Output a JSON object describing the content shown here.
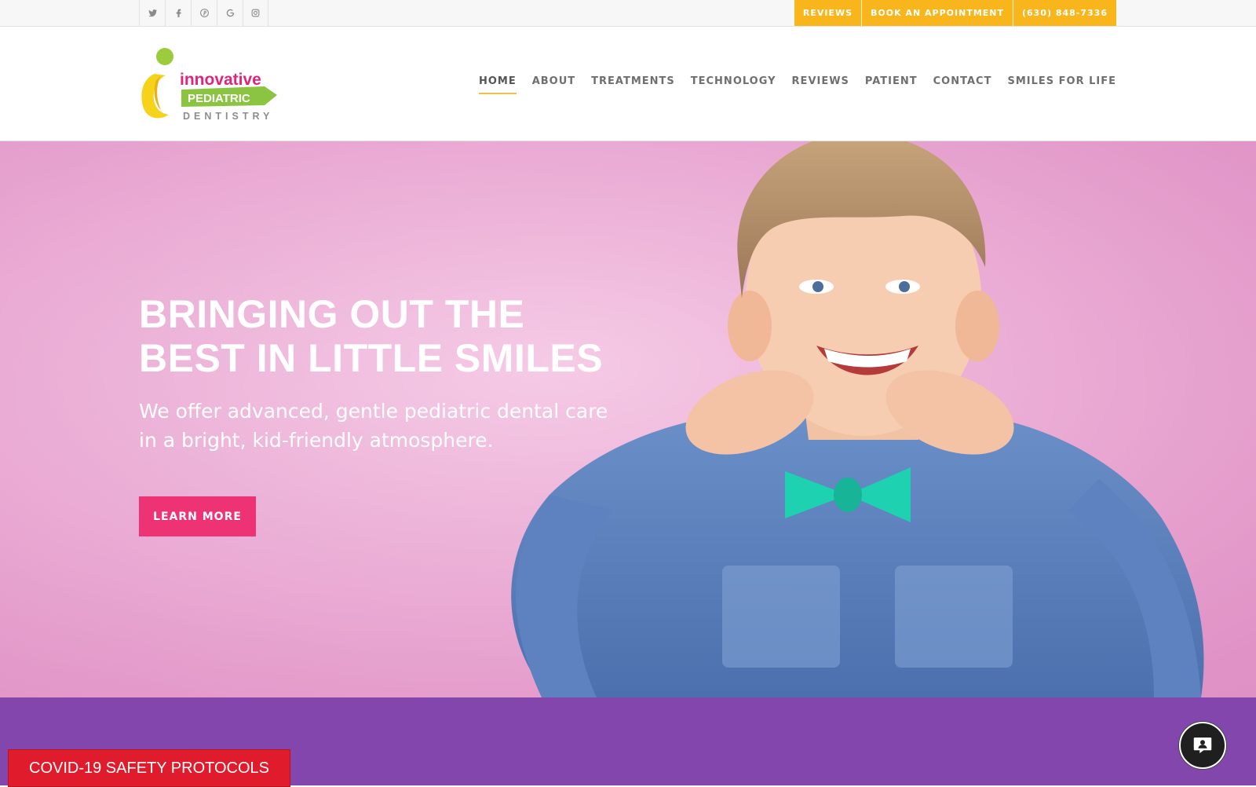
{
  "topbar": {
    "social": [
      {
        "icon": "twitter-icon"
      },
      {
        "icon": "facebook-icon"
      },
      {
        "icon": "pinterest-icon"
      },
      {
        "icon": "google-icon"
      },
      {
        "icon": "instagram-icon"
      }
    ],
    "links": [
      "REVIEWS",
      "BOOK AN APPOINTMENT",
      "(630) 848-7336"
    ]
  },
  "logo": {
    "word1": "innovative",
    "word2": "PEDIATRIC",
    "word3": "DENTISTRY"
  },
  "nav": {
    "items": [
      "HOME",
      "ABOUT",
      "TREATMENTS",
      "TECHNOLOGY",
      "REVIEWS",
      "PATIENT",
      "CONTACT",
      "SMILES FOR LIFE"
    ],
    "active": "HOME"
  },
  "hero": {
    "title_line1": "BRINGING OUT THE",
    "title_line2": "BEST IN LITTLE SMILES",
    "subtitle": "We offer advanced, gentle pediatric dental care in a bright, kid-friendly atmosphere.",
    "cta_label": "LEARN MORE"
  },
  "footer": {
    "covid_label": "COVID-19 SAFETY PROTOCOLS",
    "chat_icon": "chat-icon"
  },
  "colors": {
    "accent": "#f9b61c",
    "cta": "#ee3374",
    "band": "#8246ac",
    "covid": "#e01c2c",
    "hero_pink": "#eeb2d8"
  }
}
